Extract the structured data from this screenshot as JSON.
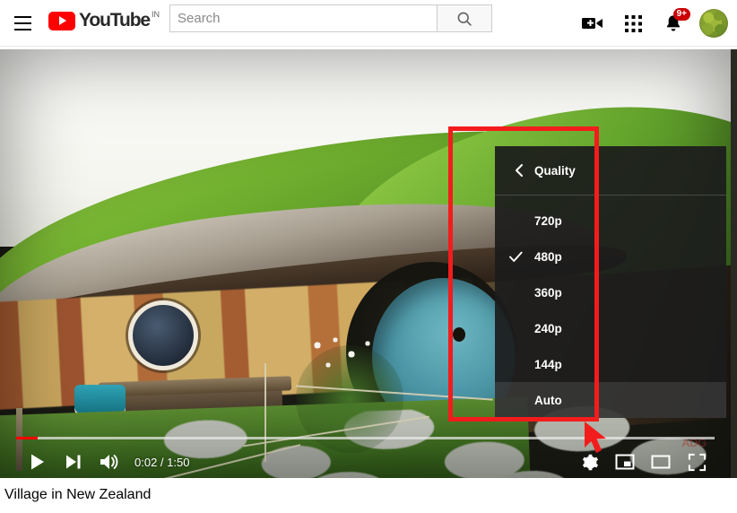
{
  "header": {
    "menu_icon": "hamburger-icon",
    "logo_text": "YouTube",
    "logo_country": "IN",
    "search": {
      "value": "",
      "placeholder": "Search"
    },
    "search_button_icon": "search-icon",
    "create_icon": "video-camera-plus-icon",
    "apps_icon": "apps-grid-icon",
    "notifications_icon": "bell-icon",
    "notifications_badge": "9+",
    "avatar_label": "account-avatar"
  },
  "player": {
    "time_display": "0:02 / 1:50",
    "current_time": "0:02",
    "duration": "1:50",
    "progress_percent": 3,
    "play_icon": "play-icon",
    "next_icon": "next-video-icon",
    "volume_icon": "volume-icon",
    "settings_icon": "gear-icon",
    "miniplayer_icon": "miniplayer-icon",
    "theater_icon": "theater-mode-icon",
    "fullscreen_icon": "fullscreen-icon",
    "watermark": "ADG"
  },
  "settings_menu": {
    "back_icon": "chevron-left-icon",
    "header_label": "Quality",
    "selected": "480p",
    "items": [
      {
        "label": "720p",
        "checked": false,
        "highlighted": false
      },
      {
        "label": "480p",
        "checked": true,
        "highlighted": false
      },
      {
        "label": "360p",
        "checked": false,
        "highlighted": false
      },
      {
        "label": "240p",
        "checked": false,
        "highlighted": false
      },
      {
        "label": "144p",
        "checked": false,
        "highlighted": false
      },
      {
        "label": "Auto",
        "checked": false,
        "highlighted": true
      }
    ]
  },
  "video": {
    "title": "Village in New Zealand"
  },
  "annotation": {
    "highlight_color": "#f31c1c",
    "cursor_color": "#f31c1c"
  }
}
